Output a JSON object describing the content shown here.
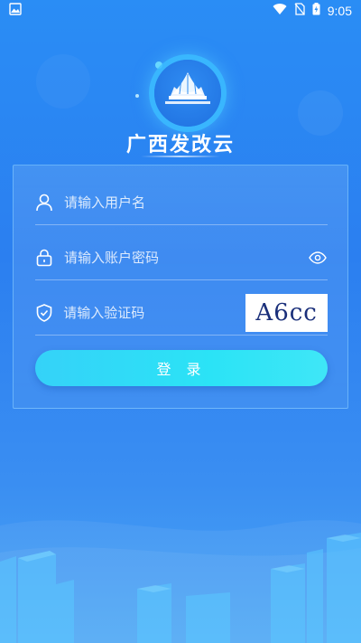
{
  "status_bar": {
    "time": "9:05",
    "icons": [
      "gallery-icon",
      "wifi-icon",
      "no-sim-icon",
      "battery-icon"
    ]
  },
  "app": {
    "title": "广西发改云",
    "logo_icon": "building-logo-icon"
  },
  "form": {
    "username": {
      "placeholder": "请输入用户名",
      "value": "",
      "icon": "user-icon"
    },
    "password": {
      "placeholder": "请输入账户密码",
      "value": "",
      "icon": "lock-icon",
      "toggle_icon": "eye-icon"
    },
    "captcha": {
      "placeholder": "请输入验证码",
      "value": "",
      "icon": "shield-icon",
      "image_text": "A6cc"
    },
    "submit_label": "登 录"
  },
  "colors": {
    "background_top": "#2a8df5",
    "background_bottom": "#4aa6f5",
    "button_start": "#35d2f8",
    "button_end": "#3fe6f7",
    "captcha_text": "#1a2f7a"
  }
}
